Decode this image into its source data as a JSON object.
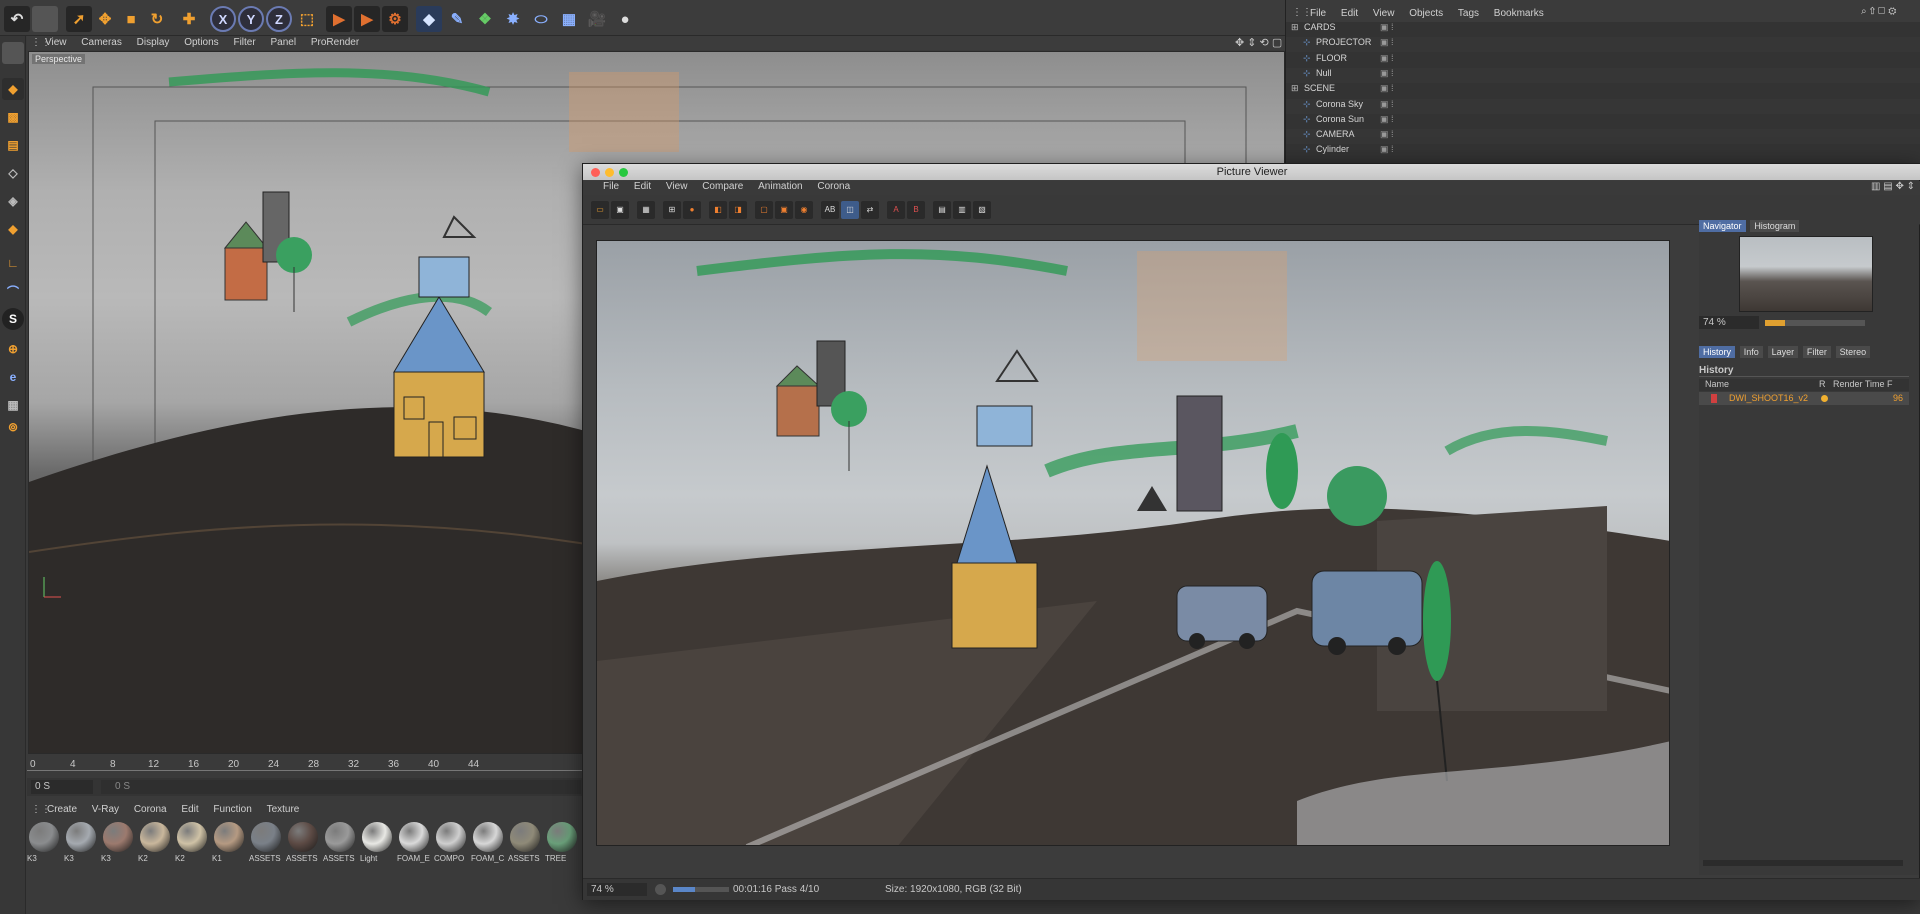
{
  "main_toolbar": {
    "x_label": "X",
    "y_label": "Y",
    "z_label": "Z"
  },
  "viewport": {
    "menu": [
      "View",
      "Cameras",
      "Display",
      "Options",
      "Filter",
      "Panel",
      "ProRender"
    ],
    "label": "Perspective"
  },
  "timeline": {
    "ticks": [
      "0",
      "4",
      "8",
      "12",
      "16",
      "20",
      "24",
      "28",
      "32",
      "36",
      "40",
      "44"
    ],
    "current_frame": "0 S",
    "end_frame_field": "0 S"
  },
  "materials": {
    "menu": [
      "Create",
      "V-Ray",
      "Corona",
      "Edit",
      "Function",
      "Texture"
    ],
    "items": [
      {
        "label": "K3",
        "color": "#8a8c8e"
      },
      {
        "label": "K3",
        "color": "#a5aab0"
      },
      {
        "label": "K3",
        "color": "#9c7a6e"
      },
      {
        "label": "K2",
        "color": "#c9b79c"
      },
      {
        "label": "K2",
        "color": "#cfc2a6"
      },
      {
        "label": "K1",
        "color": "#b59a82"
      },
      {
        "label": "ASSETS",
        "color": "#7a8088"
      },
      {
        "label": "ASSETS",
        "color": "#5c4a44"
      },
      {
        "label": "ASSETS",
        "color": "#9a9a9a"
      },
      {
        "label": "Light",
        "color": "#e8e8e4"
      },
      {
        "label": "FOAM_E",
        "color": "#dadada"
      },
      {
        "label": "COMPO",
        "color": "#cfcfcf"
      },
      {
        "label": "FOAM_C",
        "color": "#d7d7d7"
      },
      {
        "label": "ASSETS",
        "color": "#8f8a78"
      },
      {
        "label": "TREE",
        "color": "#6aa07a"
      }
    ]
  },
  "object_manager": {
    "menu": [
      "File",
      "Edit",
      "View",
      "Objects",
      "Tags",
      "Bookmarks"
    ],
    "rows": [
      {
        "name": "CARDS",
        "indent": 0
      },
      {
        "name": "PROJECTOR",
        "indent": 1
      },
      {
        "name": "FLOOR",
        "indent": 1
      },
      {
        "name": "Null",
        "indent": 1
      },
      {
        "name": "SCENE",
        "indent": 0
      },
      {
        "name": "Corona Sky",
        "indent": 1
      },
      {
        "name": "Corona Sun",
        "indent": 1
      },
      {
        "name": "CAMERA",
        "indent": 1
      },
      {
        "name": "Cylinder",
        "indent": 1
      }
    ]
  },
  "picture_viewer": {
    "title": "Picture Viewer",
    "menu": [
      "File",
      "Edit",
      "View",
      "Compare",
      "Animation",
      "Corona"
    ],
    "zoom": "74 %",
    "render_time": "00:01:16 Pass 4/10",
    "size_info": "Size: 1920x1080, RGB (32 Bit)",
    "nav_tabs": [
      "Navigator",
      "Histogram"
    ],
    "nav_zoom": "74 %",
    "side_tabs": [
      "History",
      "Info",
      "Layer",
      "Filter",
      "Stereo"
    ],
    "history_header": "History",
    "history_columns": [
      "Name",
      "R",
      "Render Time",
      "F"
    ],
    "history_rows": [
      {
        "name": "DWI_SHOOT16_v2",
        "frame": "96"
      }
    ]
  }
}
